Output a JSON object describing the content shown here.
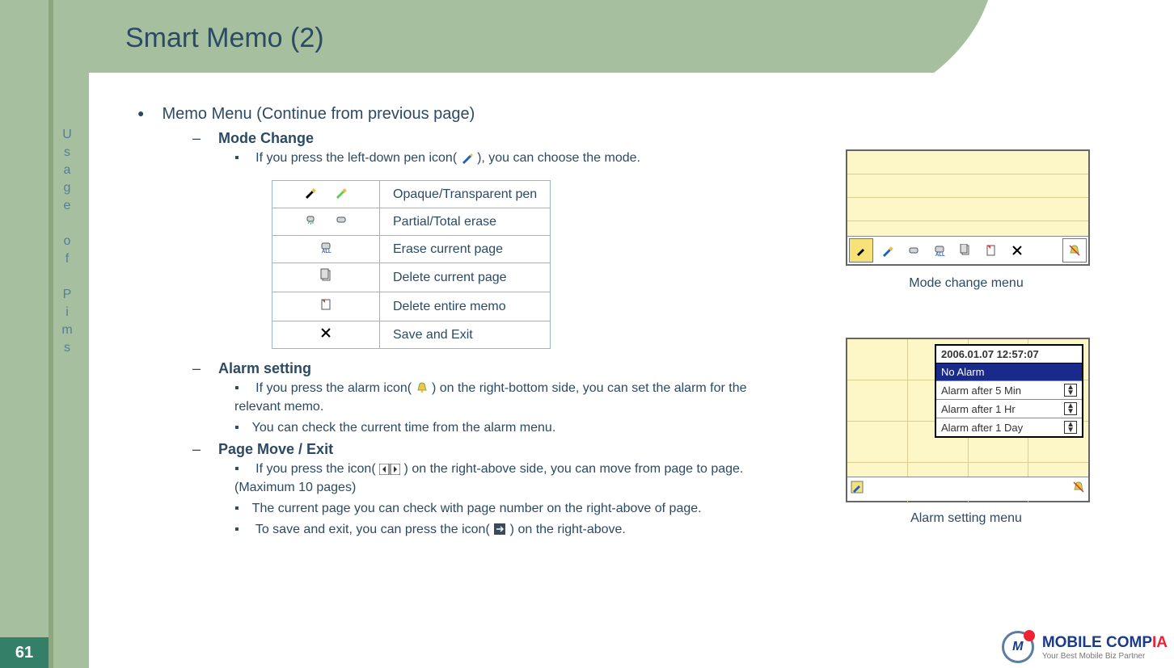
{
  "sidebar": {
    "label_chars": [
      "U",
      "s",
      "a",
      "g",
      "e",
      "",
      "o",
      "f",
      "",
      "P",
      "i",
      "m",
      "s"
    ]
  },
  "page_number": "61",
  "title": "Smart Memo (2)",
  "content": {
    "heading": "Memo Menu (Continue from previous page)",
    "mode_change": {
      "title": "Mode Change",
      "line_a": "If you press the left-down pen icon(",
      "line_b": "), you can choose the mode."
    },
    "table": [
      {
        "label": "Opaque/Transparent pen"
      },
      {
        "label": "Partial/Total erase"
      },
      {
        "label": "Erase current page"
      },
      {
        "label": "Delete current page"
      },
      {
        "label": "Delete entire memo"
      },
      {
        "label": "Save and Exit"
      }
    ],
    "alarm": {
      "title": "Alarm setting",
      "line1_a": "If you press the alarm icon(",
      "line1_b": ") on the right-bottom side, you can set the alarm for the relevant memo.",
      "line2": "You can check the current time from the alarm menu."
    },
    "page_move": {
      "title": "Page Move / Exit",
      "line1_a": "If you press the icon( ",
      "line1_b": " ) on the right-above side, you can move from page to page. (Maximum 10 pages)",
      "line2": "The current page you can check with page number on the right-above of page.",
      "line3_a": "To save and exit, you can press the icon(",
      "line3_b": ") on the right-above."
    }
  },
  "captions": {
    "mode": "Mode change menu",
    "alarm": "Alarm setting menu"
  },
  "alarm_popup": {
    "timestamp": "2006.01.07 12:57:07",
    "opt0": "No Alarm",
    "opt1": "Alarm after 5 Min",
    "opt2": "Alarm after 1 Hr",
    "opt3": "Alarm after 1 Day"
  },
  "logo": {
    "brand_a": "MOBILE COMP",
    "brand_b": "IA",
    "tagline": "Your Best Mobile Biz Partner",
    "badge": "M"
  }
}
